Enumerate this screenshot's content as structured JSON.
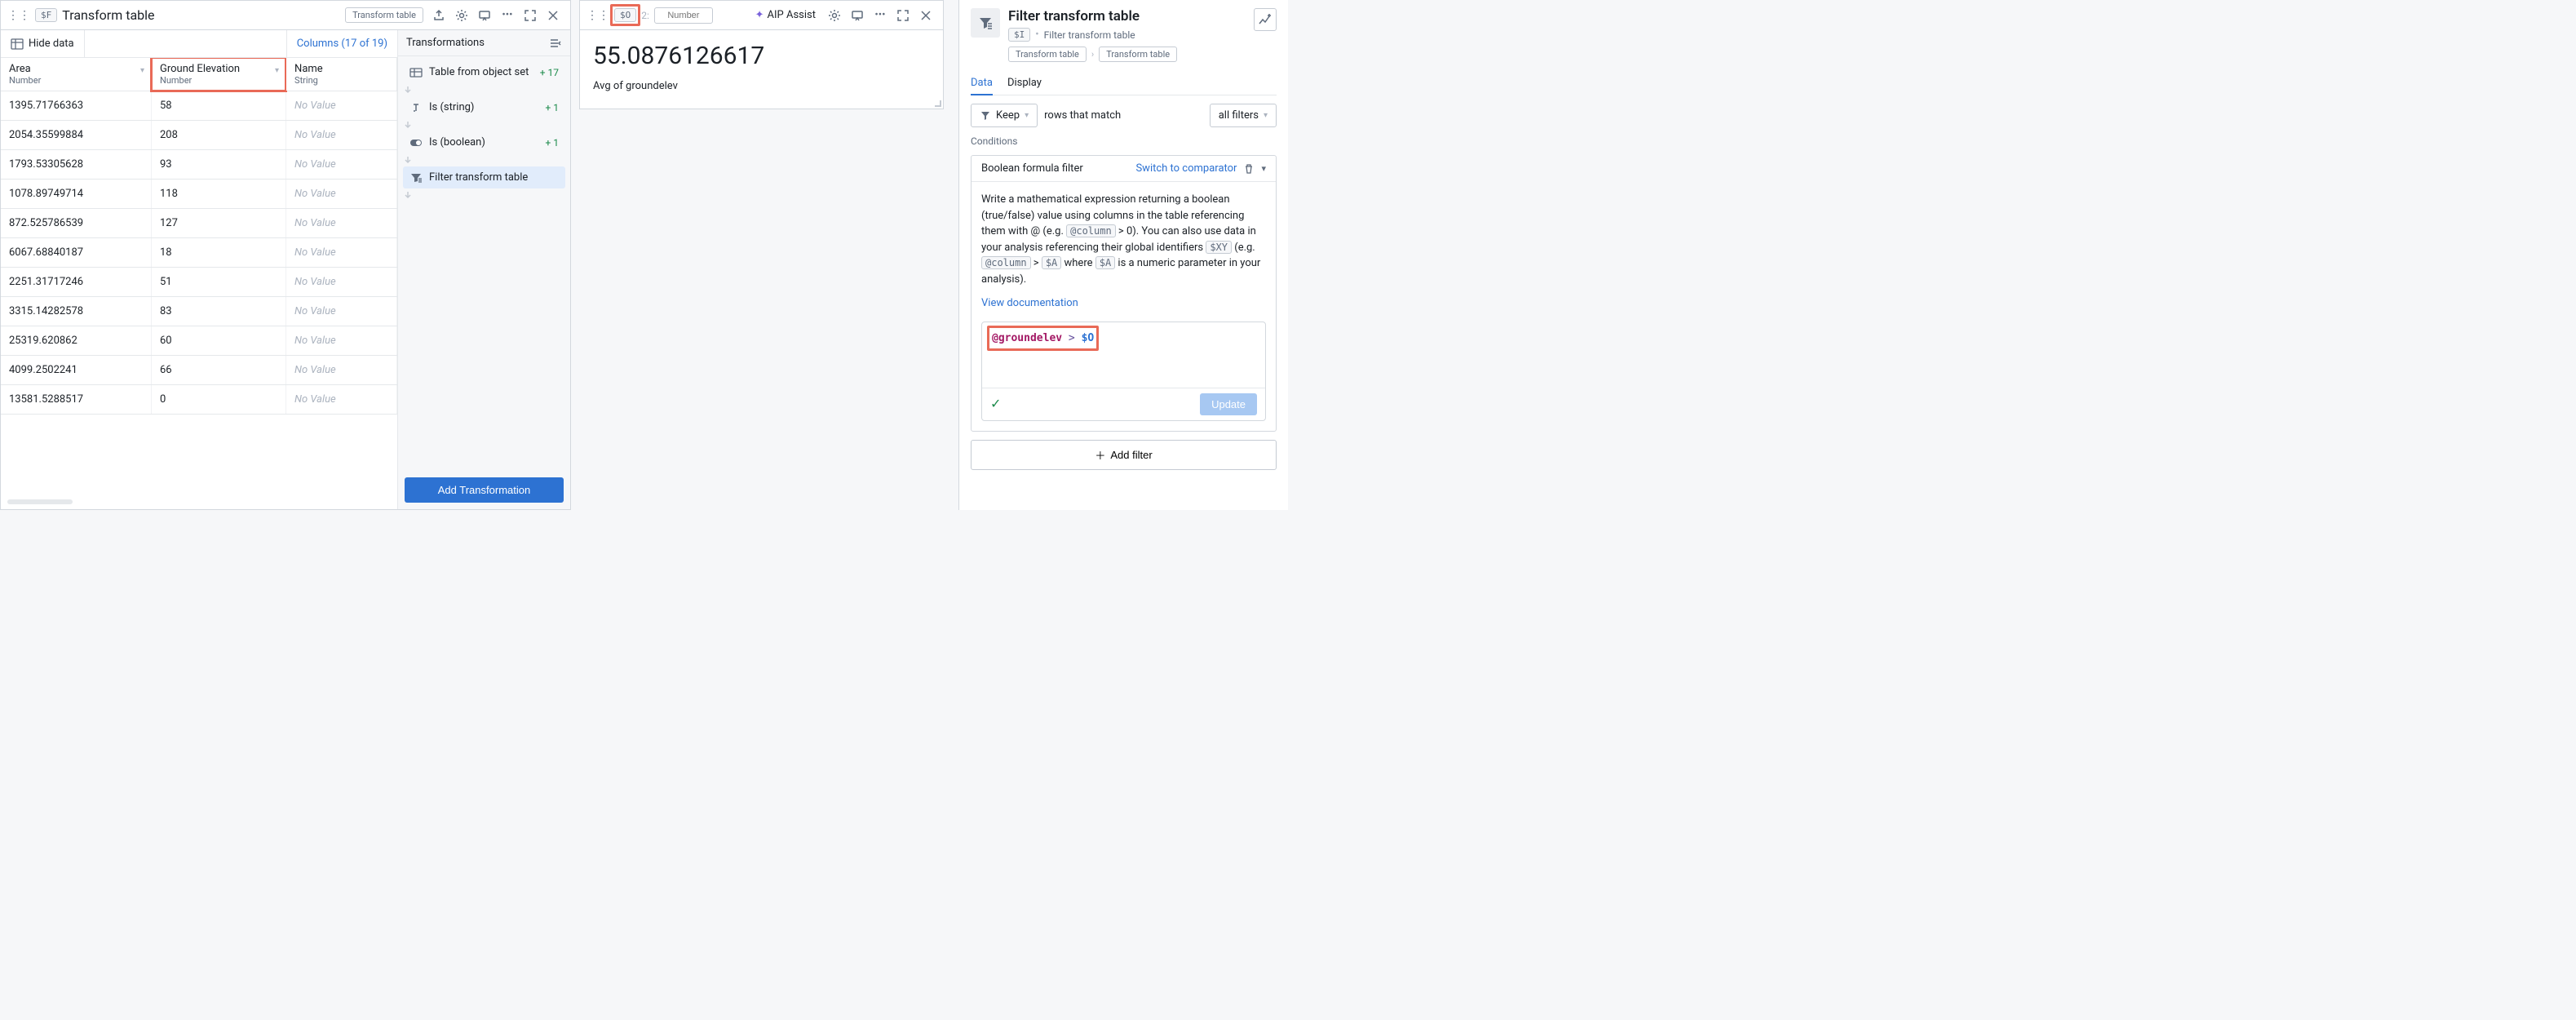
{
  "left": {
    "var": "$F",
    "title": "Transform table",
    "chip": "Transform table",
    "hide_data": "Hide data",
    "columns_link": "Columns (17 of 19)",
    "columns": [
      {
        "name": "Area",
        "type": "Number"
      },
      {
        "name": "Ground Elevation",
        "type": "Number"
      },
      {
        "name": "Name",
        "type": "String"
      }
    ],
    "rows": [
      {
        "area": "1395.71766363",
        "ge": "58",
        "name": "No Value"
      },
      {
        "area": "2054.35599884",
        "ge": "208",
        "name": "No Value"
      },
      {
        "area": "1793.53305628",
        "ge": "93",
        "name": "No Value"
      },
      {
        "area": "1078.89749714",
        "ge": "118",
        "name": "No Value"
      },
      {
        "area": "872.525786539",
        "ge": "127",
        "name": "No Value"
      },
      {
        "area": "6067.68840187",
        "ge": "18",
        "name": "No Value"
      },
      {
        "area": "2251.31717246",
        "ge": "51",
        "name": "No Value"
      },
      {
        "area": "3315.14282578",
        "ge": "83",
        "name": "No Value"
      },
      {
        "area": "25319.620862",
        "ge": "60",
        "name": "No Value"
      },
      {
        "area": "4099.2502241",
        "ge": "66",
        "name": "No Value"
      },
      {
        "area": "13581.5288517",
        "ge": "0",
        "name": "No Value"
      }
    ],
    "transforms": {
      "title": "Transformations",
      "items": [
        {
          "label": "Table from object set",
          "count": "+ 17"
        },
        {
          "label": "Is (string)",
          "count": "+ 1"
        },
        {
          "label": "Is (boolean)",
          "count": "+ 1"
        },
        {
          "label": "Filter transform table",
          "count": ""
        }
      ],
      "add": "Add Transformation"
    }
  },
  "center": {
    "var": "$O",
    "num_placeholder": "Number",
    "aip": "AIP Assist",
    "value": "55.0876126617",
    "label": "Avg of groundelev"
  },
  "right": {
    "title": "Filter transform table",
    "var": "$I",
    "meta": "Filter transform table",
    "crumbs": [
      "Transform table",
      "Transform table"
    ],
    "tabs": {
      "data": "Data",
      "display": "Display"
    },
    "keep": "Keep",
    "rows_match": "rows that match",
    "all_filters": "all filters",
    "conditions": "Conditions",
    "cond_title": "Boolean formula filter",
    "switch": "Switch to comparator",
    "help1": "Write a mathematical expression returning a boolean (true/false) value using columns in the table referencing them with @ (e.g. ",
    "help_code1": "@column",
    "help2": " > 0). You can also use data in your analysis referencing their global identifiers ",
    "help_code2": "$XY",
    "help3": " (e.g. ",
    "help_code3": "@column",
    "help4": " > ",
    "help_code4": "$A",
    "help5": " where ",
    "help_code5": "$A",
    "help6": " is a numeric parameter in your analysis).",
    "doc_link": "View documentation",
    "formula": {
      "col": "@groundelev",
      "op": ">",
      "var": "$O"
    },
    "update": "Update",
    "add_filter": "Add filter"
  }
}
